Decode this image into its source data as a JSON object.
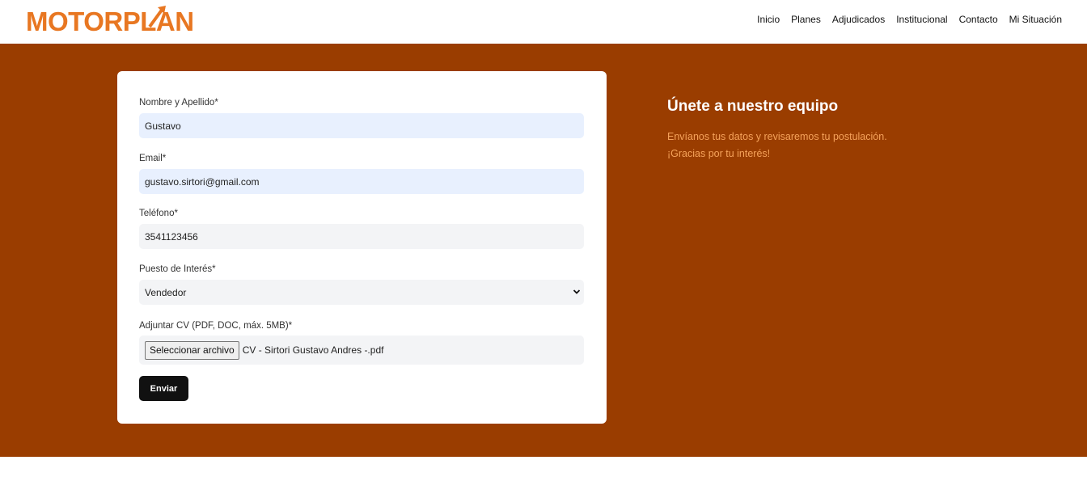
{
  "brand": {
    "name": "MOTORPLAN",
    "color": "#e87722"
  },
  "nav": {
    "items": [
      {
        "label": "Inicio"
      },
      {
        "label": "Planes"
      },
      {
        "label": "Adjudicados"
      },
      {
        "label": "Institucional"
      },
      {
        "label": "Contacto"
      },
      {
        "label": "Mi Situación"
      }
    ]
  },
  "form": {
    "name_label": "Nombre y Apellido*",
    "name_value": "Gustavo",
    "email_label": "Email*",
    "email_value": "gustavo.sirtori@gmail.com",
    "phone_label": "Teléfono*",
    "phone_value": "3541123456",
    "position_label": "Puesto de Interés*",
    "position_value": "Vendedor",
    "cv_label": "Adjuntar CV (PDF, DOC, máx. 5MB)*",
    "cv_button": "Seleccionar archivo",
    "cv_filename": "CV - Sirtori Gustavo Andres -.pdf",
    "submit_label": "Enviar"
  },
  "side": {
    "title": "Únete a nuestro equipo",
    "line1": "Envíanos tus datos y revisaremos tu postulación.",
    "line2": "¡Gracias por tu interés!"
  },
  "colors": {
    "hero_bg": "#9a3d00",
    "accent_text": "#f5a25a",
    "autofill_bg": "#e8f0fe"
  }
}
